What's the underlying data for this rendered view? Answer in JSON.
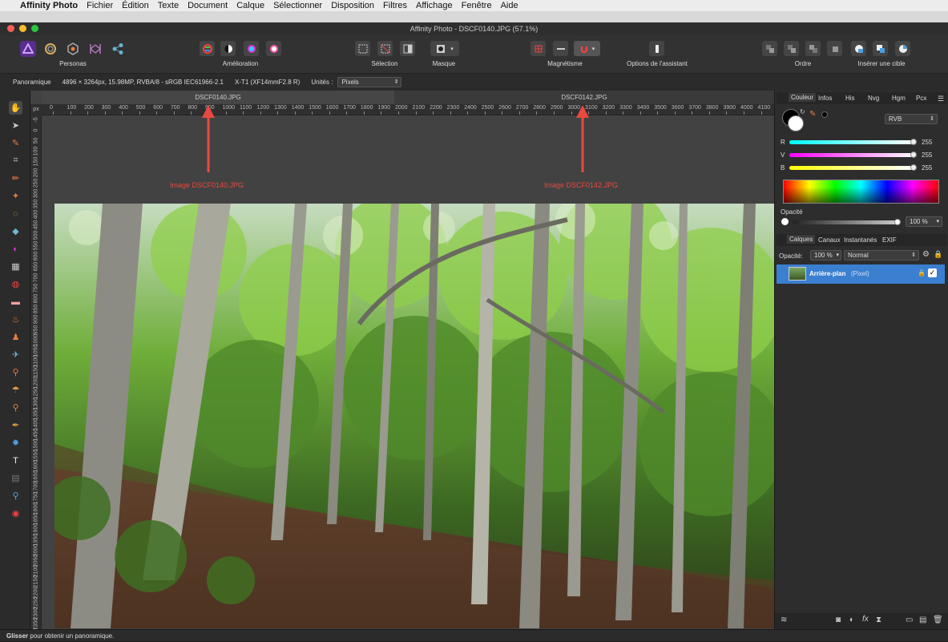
{
  "menubar": {
    "app": "Affinity Photo",
    "items": [
      "Fichier",
      "Édition",
      "Texte",
      "Document",
      "Calque",
      "Sélectionner",
      "Disposition",
      "Filtres",
      "Affichage",
      "Fenêtre",
      "Aide"
    ]
  },
  "window": {
    "title": "Affinity Photo - DSCF0140.JPG (57.1%)"
  },
  "toolbar": {
    "personas": "Personas",
    "amelioration": "Amélioration",
    "selection": "Sélection",
    "masque": "Masque",
    "magnetisme": "Magnétisme",
    "assistant": "Options de l'assistant",
    "ordre": "Ordre",
    "inserer": "Insérer une cible"
  },
  "context": {
    "tool": "Panoramique",
    "info": "4896 × 3264px, 15.98MP, RVBA/8 - sRGB IEC61966-2.1",
    "camera": "X-T1 (XF14mmF2.8 R)",
    "units_label": "Unités :",
    "units_value": "Pixels"
  },
  "tabs": {
    "left": "DSCF0140.JPG",
    "right": "DSCF0142.JPG"
  },
  "rulers": {
    "unit": "px",
    "h": [
      "0",
      "100",
      "200",
      "300",
      "400",
      "500",
      "600",
      "700",
      "800",
      "900",
      "1000",
      "1100",
      "1200",
      "1300",
      "1400",
      "1500",
      "1600",
      "1700",
      "1800",
      "1900",
      "2000",
      "2100",
      "2200",
      "2300",
      "2400",
      "2500",
      "2600",
      "2700",
      "2800",
      "2900",
      "3000",
      "3100",
      "3200",
      "3300",
      "3400",
      "3500",
      "3600",
      "3700",
      "3800",
      "3900",
      "4000",
      "4100"
    ],
    "v": [
      "-5",
      "0",
      "50",
      "100",
      "150",
      "200",
      "250",
      "300",
      "350",
      "400",
      "450",
      "500",
      "550",
      "600",
      "650",
      "700",
      "750",
      "800",
      "850",
      "900",
      "950",
      "1000",
      "1050",
      "1100",
      "1150",
      "1200",
      "1250",
      "1300",
      "1350",
      "1400",
      "1450",
      "1500",
      "1550",
      "1600",
      "1650",
      "1700",
      "1750",
      "1800",
      "1850",
      "1900",
      "1950",
      "2000",
      "2050",
      "2100",
      "2150",
      "2200",
      "2250",
      "2300",
      "2350",
      "2400"
    ]
  },
  "annotations": {
    "left": "Image DSCF0140.JPG",
    "right": "Image DSCF0142.JPG",
    "color": "#e8493f"
  },
  "status": {
    "bold": "Glisser",
    "text": " pour obtenir un panoramique."
  },
  "color_panel": {
    "tabs": [
      "Couleur",
      "Infos",
      "His",
      "Nvg",
      "Hgm",
      "Pcx"
    ],
    "model": "RVB",
    "r_label": "R",
    "r_value": "255",
    "g_label": "V",
    "g_value": "255",
    "b_label": "B",
    "b_value": "255",
    "opacity_label": "Opacité",
    "opacity_value": "100 %"
  },
  "layers_panel": {
    "tabs": [
      "Calques",
      "Canaux",
      "Instantanés",
      "EXIF"
    ],
    "opacity_label": "Opacité:",
    "opacity_value": "100 %",
    "blend": "Normal",
    "layer_name": "Arrière-plan",
    "layer_type": "(Pixel)"
  }
}
